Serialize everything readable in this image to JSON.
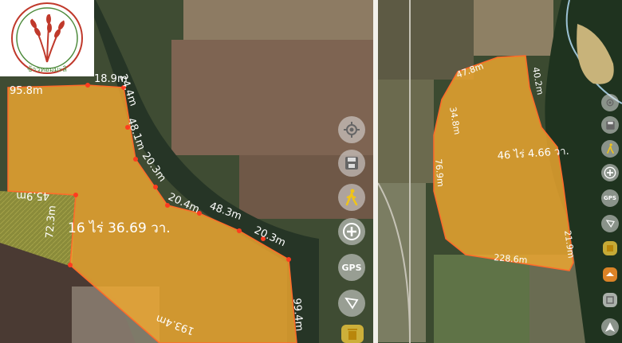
{
  "left_map": {
    "area_label": "16 ไร่ 36.69 วา.",
    "edge_labels": [
      "95.8m",
      "18.9m",
      "24.4m",
      "48.1m",
      "20.3m",
      "20.4m",
      "48.3m",
      "20.3m",
      "45.9m",
      "72.3m",
      "193.4m",
      "99.4m"
    ],
    "controls": {
      "locate_icon": "crosshair-icon",
      "save_icon": "floppy-icon",
      "walk_icon": "walking-person-icon",
      "add_icon": "plus-icon",
      "gps_label": "GPS",
      "shape_icon": "polygon-icon",
      "delete_icon": "trash-icon"
    }
  },
  "right_map": {
    "area_label": "46 ไร่ 4.66 วา.",
    "edge_labels": [
      "228.6m",
      "47.8m",
      "34.8m",
      "76.9m",
      "40.2m",
      "21.9m"
    ],
    "controls": {
      "save_icon": "floppy-icon",
      "walk_icon": "walking-person-icon",
      "add_icon": "plus-icon",
      "gps_label": "GPS",
      "shape_icon": "polygon-icon",
      "layers_icon": "layers-icon",
      "send_icon": "send-arrow-icon"
    }
  },
  "logo": {
    "text": "ข้าวหอมมะลิ"
  },
  "colors": {
    "field_fill": "#f0a830",
    "outline": "#ff6a2a",
    "vertex": "#ff3b1f",
    "label": "#ffffff"
  }
}
